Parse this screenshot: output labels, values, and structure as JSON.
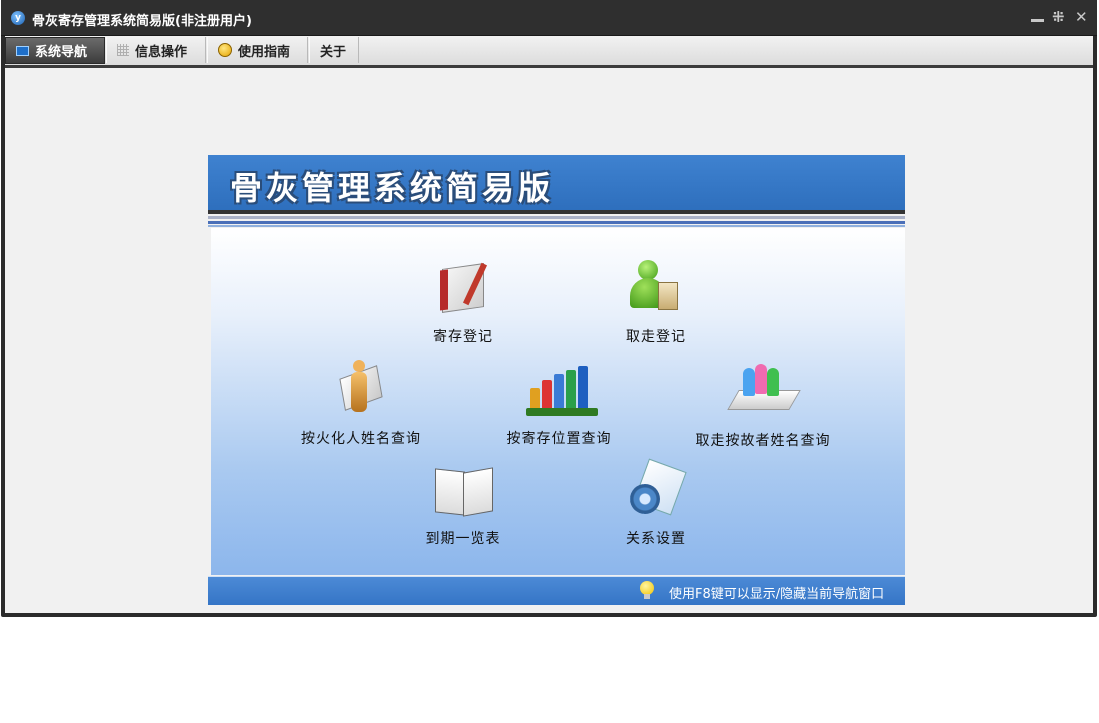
{
  "window": {
    "title": "骨灰寄存管理系统简易版(非注册用户)",
    "app_icon": "app-logo-icon",
    "controls": [
      "minimize-icon",
      "restore-icon",
      "close-icon"
    ]
  },
  "menu": {
    "tabs": [
      {
        "label": "系统导航",
        "icon": "monitor-icon",
        "active": true
      },
      {
        "label": "信息操作",
        "icon": "grid-icon",
        "active": false
      },
      {
        "label": "使用指南",
        "icon": "smiley-icon",
        "active": false
      },
      {
        "label": "关于",
        "icon": "",
        "active": false
      }
    ]
  },
  "panel": {
    "title": "骨灰管理系统简易版",
    "items": [
      {
        "label": "寄存登记",
        "icon": "register-book-icon"
      },
      {
        "label": "取走登记",
        "icon": "pickup-person-icon"
      },
      {
        "label": "按火化人姓名查询",
        "icon": "person-search-icon"
      },
      {
        "label": "按寄存位置查询",
        "icon": "bookshelf-icon"
      },
      {
        "label": "取走按故者姓名查询",
        "icon": "group-search-icon"
      },
      {
        "label": "到期一览表",
        "icon": "open-book-icon"
      },
      {
        "label": "关系设置",
        "icon": "settings-gear-icon"
      }
    ],
    "footer_hint": "使用F8键可以显示/隐藏当前导航窗口"
  },
  "colors": {
    "titlebar": "#2f2f2f",
    "banner": "#3a7bc8",
    "accent": "#3575c6"
  }
}
